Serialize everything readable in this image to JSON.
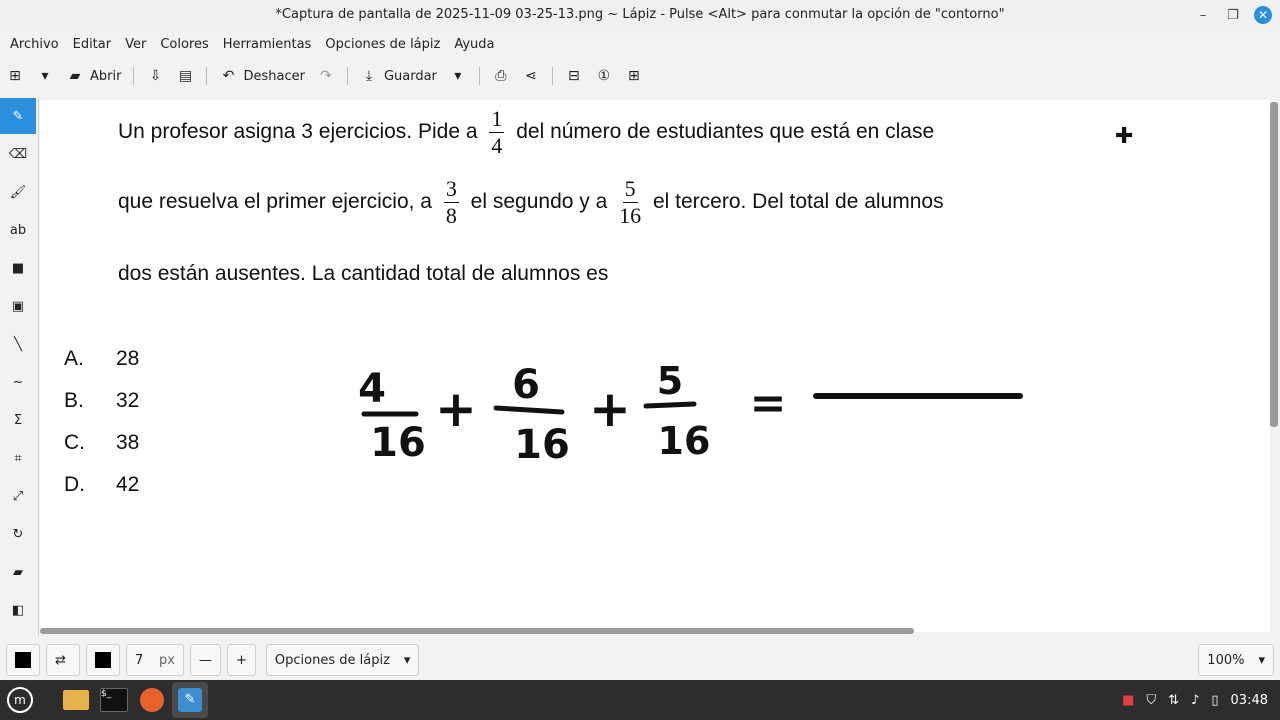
{
  "window": {
    "title": "*Captura de pantalla de 2025-11-09 03-25-13.png ~ Lápiz - Pulse <Alt> para conmutar la opción de \"contorno\""
  },
  "menu": [
    "Archivo",
    "Editar",
    "Ver",
    "Colores",
    "Herramientas",
    "Opciones de lápiz",
    "Ayuda"
  ],
  "toolbar": {
    "open_label": "Abrir",
    "undo_label": "Deshacer",
    "save_label": "Guardar"
  },
  "problem": {
    "line1_a": "Un profesor asigna 3 ejercicios. Pide a",
    "f1_num": "1",
    "f1_den": "4",
    "line1_b": "del número de estudiantes que está en clase",
    "line2_a": "que resuelva el primer ejercicio, a",
    "f2_num": "3",
    "f2_den": "8",
    "line2_b": "el segundo y a",
    "f3_num": "5",
    "f3_den": "16",
    "line2_c": "el tercero. Del total de alumnos",
    "line3": "dos están ausentes. La cantidad total de alumnos es"
  },
  "options": [
    {
      "letter": "A.",
      "value": "28"
    },
    {
      "letter": "B.",
      "value": "32"
    },
    {
      "letter": "C.",
      "value": "38"
    },
    {
      "letter": "D.",
      "value": "42"
    }
  ],
  "handwriting": {
    "n1": "4",
    "d1": "16",
    "n2": "6",
    "d2": "16",
    "n3": "5",
    "d3": "16",
    "plus": "+",
    "equals": "="
  },
  "statusbar": {
    "size_value": "7",
    "size_unit": "px",
    "tool_options": "Opciones de lápiz",
    "zoom": "100%"
  },
  "taskbar": {
    "clock": "03:48"
  },
  "colors": {
    "accent": "#2b8fe0",
    "taskbar": "#2d2d2d"
  }
}
